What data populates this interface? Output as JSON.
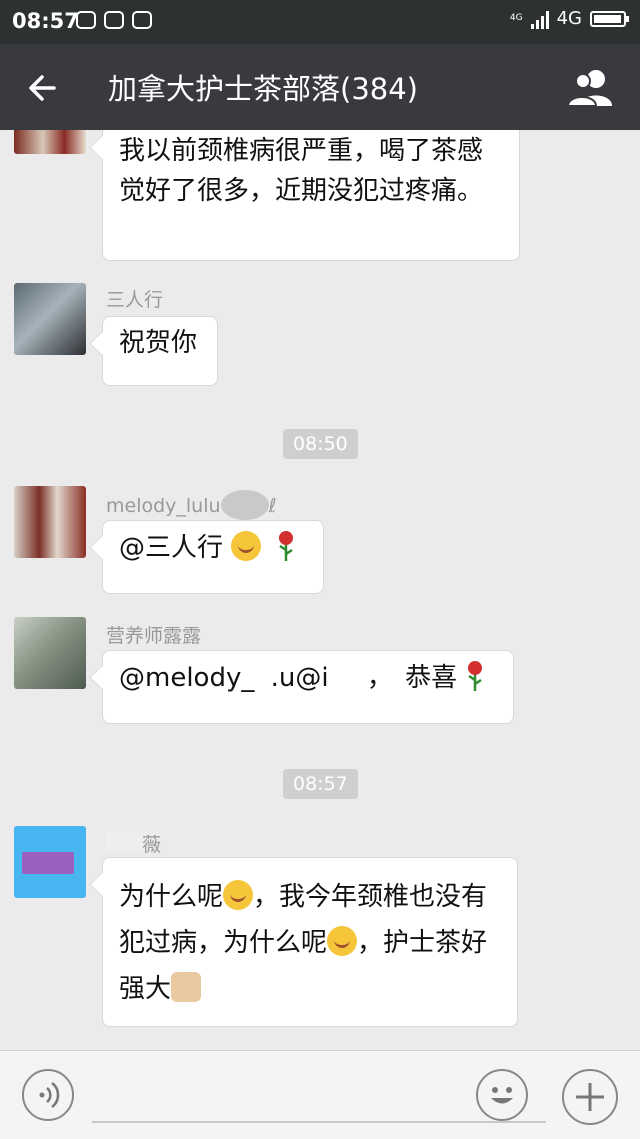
{
  "status_bar": {
    "time": "08:57",
    "network_small": "4G",
    "network": "4G"
  },
  "header": {
    "title": "加拿大护士茶部落(384)"
  },
  "messages": {
    "m1": {
      "text": "我以前颈椎病很严重，喝了茶感觉好了很多，近期没犯过疼痛。"
    },
    "m2": {
      "sender": "三人行",
      "text": "祝贺你"
    },
    "ts1": "08:50",
    "m3": {
      "sender": "melody_lulu",
      "sender_suffix": "ℓ",
      "text": "@三人行 "
    },
    "m4": {
      "sender": "营养师露露",
      "text_a": "@melody_",
      "text_b": ".u@i",
      "text_c": "，",
      "text_d": "恭喜"
    },
    "ts2": "08:57",
    "m5": {
      "sender": "薇",
      "text_1": "为什么呢",
      "text_2": "，我今年颈椎也没有犯过病，为什么呢",
      "text_3": "，护士茶好强大"
    }
  },
  "colors": {
    "navbar": "#393a3f",
    "statusbar": "#2e3132",
    "background": "#ebebeb"
  },
  "icons": [
    "back-arrow-icon",
    "group-members-icon",
    "voice-icon",
    "emoji-icon",
    "plus-icon",
    "smile-emoji-icon",
    "rose-icon",
    "thumbs-up-icon"
  ]
}
